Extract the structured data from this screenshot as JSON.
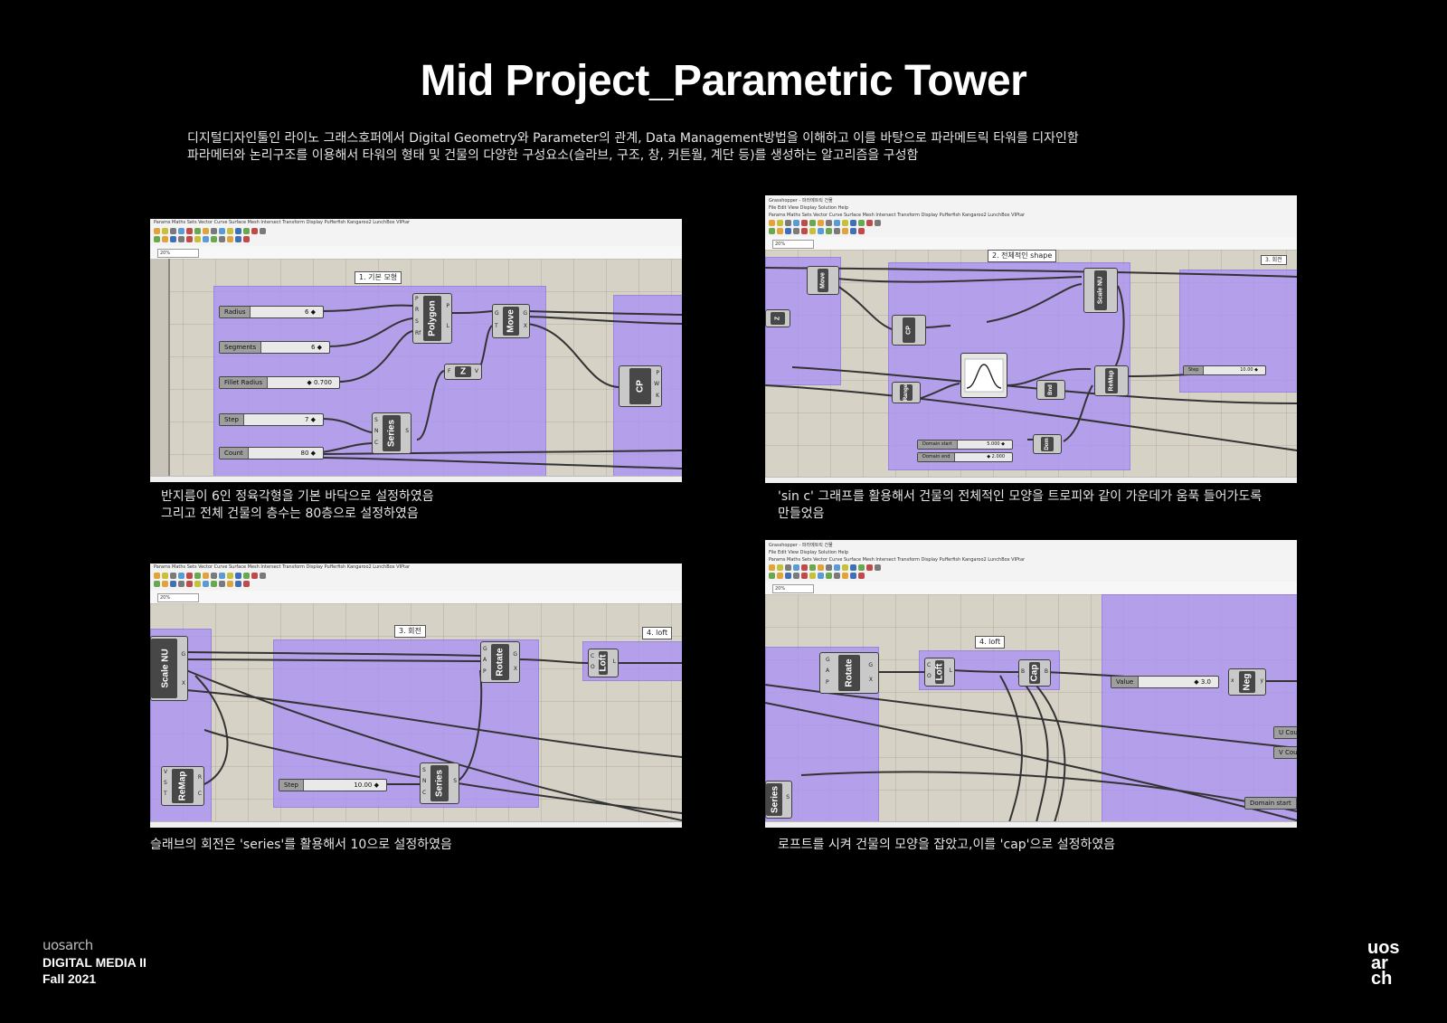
{
  "page": {
    "title": "Mid Project_Parametric Tower",
    "intro_line1": "디지털디자인툴인 라이노 그래스호퍼에서 Digital Geometry와 Parameter의 관계, Data Management방법을 이해하고 이를 바탕으로 파라메트릭 타워를 디자인함",
    "intro_line2": "파라메터와 논리구조를 이용해서 타워의 형태 및 건물의 다양한 구성요소(슬라브, 구조, 창, 커튼월, 계단 등)를 생성하는 알고리즘을 구성함"
  },
  "panels": [
    {
      "caption_line1": "반지름이 6인 정육각형을 기본 바닥으로 설정하였음",
      "caption_line2": "그리고 전체 건물의 층수는 80층으로 설정하였음",
      "group_label": "1. 기본 모형",
      "zoom": "20%",
      "sliders": [
        {
          "label": "Radius",
          "value": "6 ◆"
        },
        {
          "label": "Segments",
          "value": "6 ◆"
        },
        {
          "label": "Fillet Radius",
          "value": "◆ 0.700"
        },
        {
          "label": "Step",
          "value": "7 ◆"
        },
        {
          "label": "Count",
          "value": "80 ◆"
        }
      ],
      "components": [
        "Polygon",
        "Move",
        "Z",
        "Series",
        "CP"
      ]
    },
    {
      "caption_line1": "'sin c' 그래프를 활용해서 건물의 전체적인 모양을 트로피와 같이 가운데가 움푹 들어가도록",
      "caption_line2": "만들었음",
      "group_label": "2. 전체적인 shape",
      "group_label_2": "3. 회전",
      "zoom": "20%",
      "sliders": [
        {
          "label": "Step",
          "value": "10.00 ◆"
        },
        {
          "label": "Domain start",
          "value": "5.000 ◆"
        },
        {
          "label": "Domain end",
          "value": "◆ 2.000"
        }
      ],
      "components": [
        "Move",
        "Z",
        "CP",
        "Scale NU",
        "ReMap",
        "Bnd",
        "Dom",
        "Range"
      ]
    },
    {
      "caption_line1": "슬래브의 회전은 'series'를 활용해서 10으로 설정하였음",
      "group_label": "3. 회전",
      "group_label_2": "4. loft",
      "zoom": "20%",
      "sliders": [
        {
          "label": "Step",
          "value": "10.00 ◆"
        }
      ],
      "components": [
        "Scale NU",
        "Rotate",
        "Loft",
        "ReMap",
        "Series"
      ]
    },
    {
      "caption_line1": "로프트를 시켜 건물의 모양을 잡았고,이를 'cap'으로 설정하였음",
      "group_label": "4. loft",
      "zoom": "20%",
      "sliders": [
        {
          "label": "Value",
          "value": "◆ 3.0"
        }
      ],
      "side_labels": [
        "U Cou",
        "V Cou",
        "Domain start"
      ],
      "components": [
        "Rotate",
        "Loft",
        "Cap",
        "Neg",
        "Series"
      ]
    }
  ],
  "footer": {
    "logo": "uosarch",
    "course": "DIGITAL MEDIA II",
    "term": "Fall 2021",
    "brand_lines": [
      "uos",
      "ar",
      "ch"
    ]
  },
  "colors": {
    "background": "#000000",
    "group_fill": "#aa91f5",
    "canvas": "#d7d2c6",
    "component": "#474747"
  }
}
